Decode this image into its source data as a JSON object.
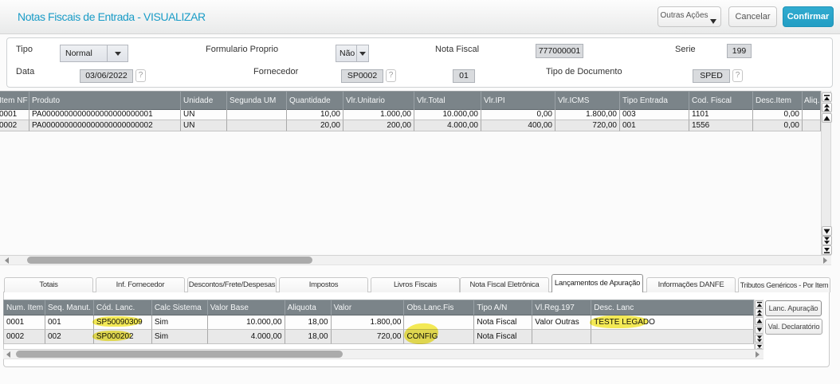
{
  "header": {
    "title": "Notas Fiscais de Entrada - VISUALIZAR",
    "buttons": {
      "outras_acoes": "Outras Ações",
      "cancelar": "Cancelar",
      "confirmar": "Confirmar"
    }
  },
  "form": {
    "tipo": {
      "label": "Tipo",
      "value": "Normal"
    },
    "formulario_proprio": {
      "label": "Formulario Proprio",
      "value": "Não"
    },
    "nota_fiscal": {
      "label": "Nota Fiscal",
      "value": "777000001"
    },
    "serie": {
      "label": "Serie",
      "value": "199"
    },
    "data": {
      "label": "Data",
      "value": "03/06/2022",
      "help": "?"
    },
    "fornecedor": {
      "label": "Fornecedor",
      "value": "SP0002",
      "help": "?"
    },
    "loja": {
      "value": "01"
    },
    "tipo_documento": {
      "label": "Tipo de Documento",
      "value": "SPED",
      "help": "?"
    }
  },
  "items_grid": {
    "columns": [
      "Item NF",
      "Produto",
      "Unidade",
      "Segunda UM",
      "Quantidade",
      "Vlr.Unitario",
      "Vlr.Total",
      "Vlr.IPI",
      "Vlr.ICMS",
      "Tipo Entrada",
      "Cod. Fiscal",
      "Desc.Item",
      "Aliq. IPI"
    ],
    "rows": [
      [
        "0001",
        "PA0000000000000000000000001",
        "UN",
        "",
        "10,00",
        "1.000,00",
        "10.000,00",
        "0,00",
        "1.800,00",
        "003",
        "1101",
        "0,00",
        ""
      ],
      [
        "0002",
        "PA0000000000000000000000002",
        "UN",
        "",
        "20,00",
        "200,00",
        "4.000,00",
        "400,00",
        "720,00",
        "001",
        "1556",
        "0,00",
        ""
      ]
    ]
  },
  "tabs": {
    "items": [
      "Totais",
      "Inf. Fornecedor",
      "Descontos/Frete/Despesas",
      "Impostos",
      "Livros Fiscais",
      "Nota Fiscal Eletrônica",
      "Lançamentos de Apuração",
      "Informações DANFE",
      "Tributos Genéricos - Por Item"
    ],
    "active": "Lançamentos de Apuração"
  },
  "apuracao_grid": {
    "columns": [
      "Num. Item",
      "Seq. Manut.",
      "Cód. Lanc.",
      "Calc Sistema",
      "Valor Base",
      "Aliquota",
      "Valor",
      "Obs.Lanc.Fis",
      "Tipo A/N",
      "Vl.Reg.197",
      "Desc. Lanc"
    ],
    "rows": [
      [
        "0001",
        "001",
        "SP50090309",
        "Sim",
        "10.000,00",
        "18,00",
        "1.800,00",
        "",
        "Nota Fiscal",
        "Valor Outras",
        "TESTE LEGADO"
      ],
      [
        "0002",
        "002",
        "SP000202",
        "Sim",
        "4.000,00",
        "18,00",
        "720,00",
        "CONFIG",
        "Nota Fiscal",
        "",
        ""
      ]
    ],
    "side_buttons": {
      "lanc_apuracao": "Lanc. Apuração",
      "val_declaratorio": "Val. Declaratório"
    },
    "annotations": {
      "highlighted_values": [
        "SP50090309",
        "SP000202",
        "CONFIG",
        "TESTE LEGADO"
      ],
      "highlight_color": "#f2e62a"
    }
  }
}
